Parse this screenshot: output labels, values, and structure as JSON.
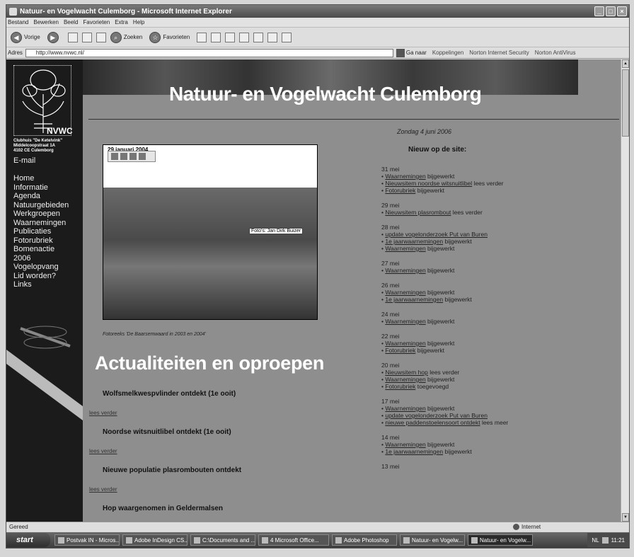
{
  "window": {
    "title": "Natuur- en Vogelwacht Culemborg - Microsoft Internet Explorer"
  },
  "menu": [
    "Bestand",
    "Bewerken",
    "Beeld",
    "Favorieten",
    "Extra",
    "Help"
  ],
  "toolbar": {
    "back": "Vorige",
    "search": "Zoeken",
    "favorites": "Favorieten"
  },
  "address": {
    "label": "Adres",
    "url": "http://www.nvwc.nl/",
    "go": "Ga naar",
    "links": "Koppelingen",
    "norton1": "Norton Internet Security",
    "norton2": "Norton AntiVirus"
  },
  "site": {
    "title": "Natuur- en Vogelwacht Culemborg",
    "clubhuis": [
      "Clubhuis \"De Ketelvink\"",
      "Middelcoopstraat 1A",
      "4102 CE Culemborg"
    ],
    "email": "E-mail",
    "nav": [
      "Home",
      "Informatie",
      "Agenda",
      "Natuurgebieden",
      "Werkgroepen",
      "Waarnemingen",
      "Publicaties",
      "Fotorubriek",
      "Bomenactie",
      "2006",
      "Vogelopvang",
      "Lid worden?",
      "Links"
    ],
    "date": "Zondag 4 juni 2006",
    "nieuw": "Nieuw op de site:",
    "photo": {
      "date": "29 januari 2004",
      "credit": "Foto's: Jan Dirk Buizer",
      "caption": "Fotoreeks 'De Baarsemwaard in 2003 en 2004'"
    },
    "actualiteiten": "Actualiteiten en oproepen",
    "news": [
      "Wolfsmelkwespvlinder ontdekt (1e ooit)",
      "Noordse witsnuitlibel ontdekt (1e ooit)",
      "Nieuwe populatie plasrombouten ontdekt",
      "Hop waargenomen in Geldermalsen"
    ],
    "lees": "lees verder",
    "updates": [
      {
        "d": "31 mei",
        "items": [
          [
            "Waarnemingen",
            "bijgewerkt"
          ],
          [
            "Nieuwsitem noordse witsnuitlibel",
            "lees verder"
          ],
          [
            "Fotorubriek",
            "bijgewerkt"
          ]
        ]
      },
      {
        "d": "29 mei",
        "items": [
          [
            "Nieuwsitem plasrombout",
            "lees verder"
          ]
        ]
      },
      {
        "d": "28 mei",
        "items": [
          [
            "update vogelonderzoek Put van Buren",
            ""
          ],
          [
            "1e jaarwaarnemingen",
            "bijgewerkt"
          ],
          [
            "Waarnemingen",
            "bijgewerkt"
          ]
        ]
      },
      {
        "d": "27 mei",
        "items": [
          [
            "Waarnemingen",
            "bijgewerkt"
          ]
        ]
      },
      {
        "d": "26 mei",
        "items": [
          [
            "Waarnemingen",
            "bijgewerkt"
          ],
          [
            "1e jaarwaarnemingen",
            "bijgewerkt"
          ]
        ]
      },
      {
        "d": "24 mei",
        "items": [
          [
            "Waarnemingen",
            "bijgewerkt"
          ]
        ]
      },
      {
        "d": "22 mei",
        "items": [
          [
            "Waarnemingen",
            "bijgewerkt"
          ],
          [
            "Fotorubriek",
            "bijgewerkt"
          ]
        ]
      },
      {
        "d": "20 mei",
        "items": [
          [
            "Nieuwsitem hop",
            "lees verder"
          ],
          [
            "Waarnemingen",
            "bijgewerkt"
          ],
          [
            "Fotorubriek",
            "toegevoegd"
          ]
        ]
      },
      {
        "d": "17 mei",
        "items": [
          [
            "Waarnemingen",
            "bijgewerkt"
          ],
          [
            "update vogelonderzoek Put van Buren",
            ""
          ],
          [
            "nieuwe paddenstoelensoort ontdekt",
            "lees meer"
          ]
        ]
      },
      {
        "d": "14 mei",
        "items": [
          [
            "Waarnemingen",
            "bijgewerkt"
          ],
          [
            "1e jaarwaarnemingen",
            "bijgewerkt"
          ]
        ]
      },
      {
        "d": "13 mei",
        "items": []
      }
    ]
  },
  "status": {
    "text": "Gereed",
    "zone": "Internet"
  },
  "taskbar": {
    "start": "start",
    "tasks": [
      "Postvak IN - Micros...",
      "Adobe InDesign CS...",
      "C:\\Documents and ...",
      "4 Microsoft Office...",
      "Adobe Photoshop",
      "Natuur- en Vogelw...",
      "Natuur- en Vogelw..."
    ],
    "lang": "NL",
    "clock": "11:21"
  }
}
